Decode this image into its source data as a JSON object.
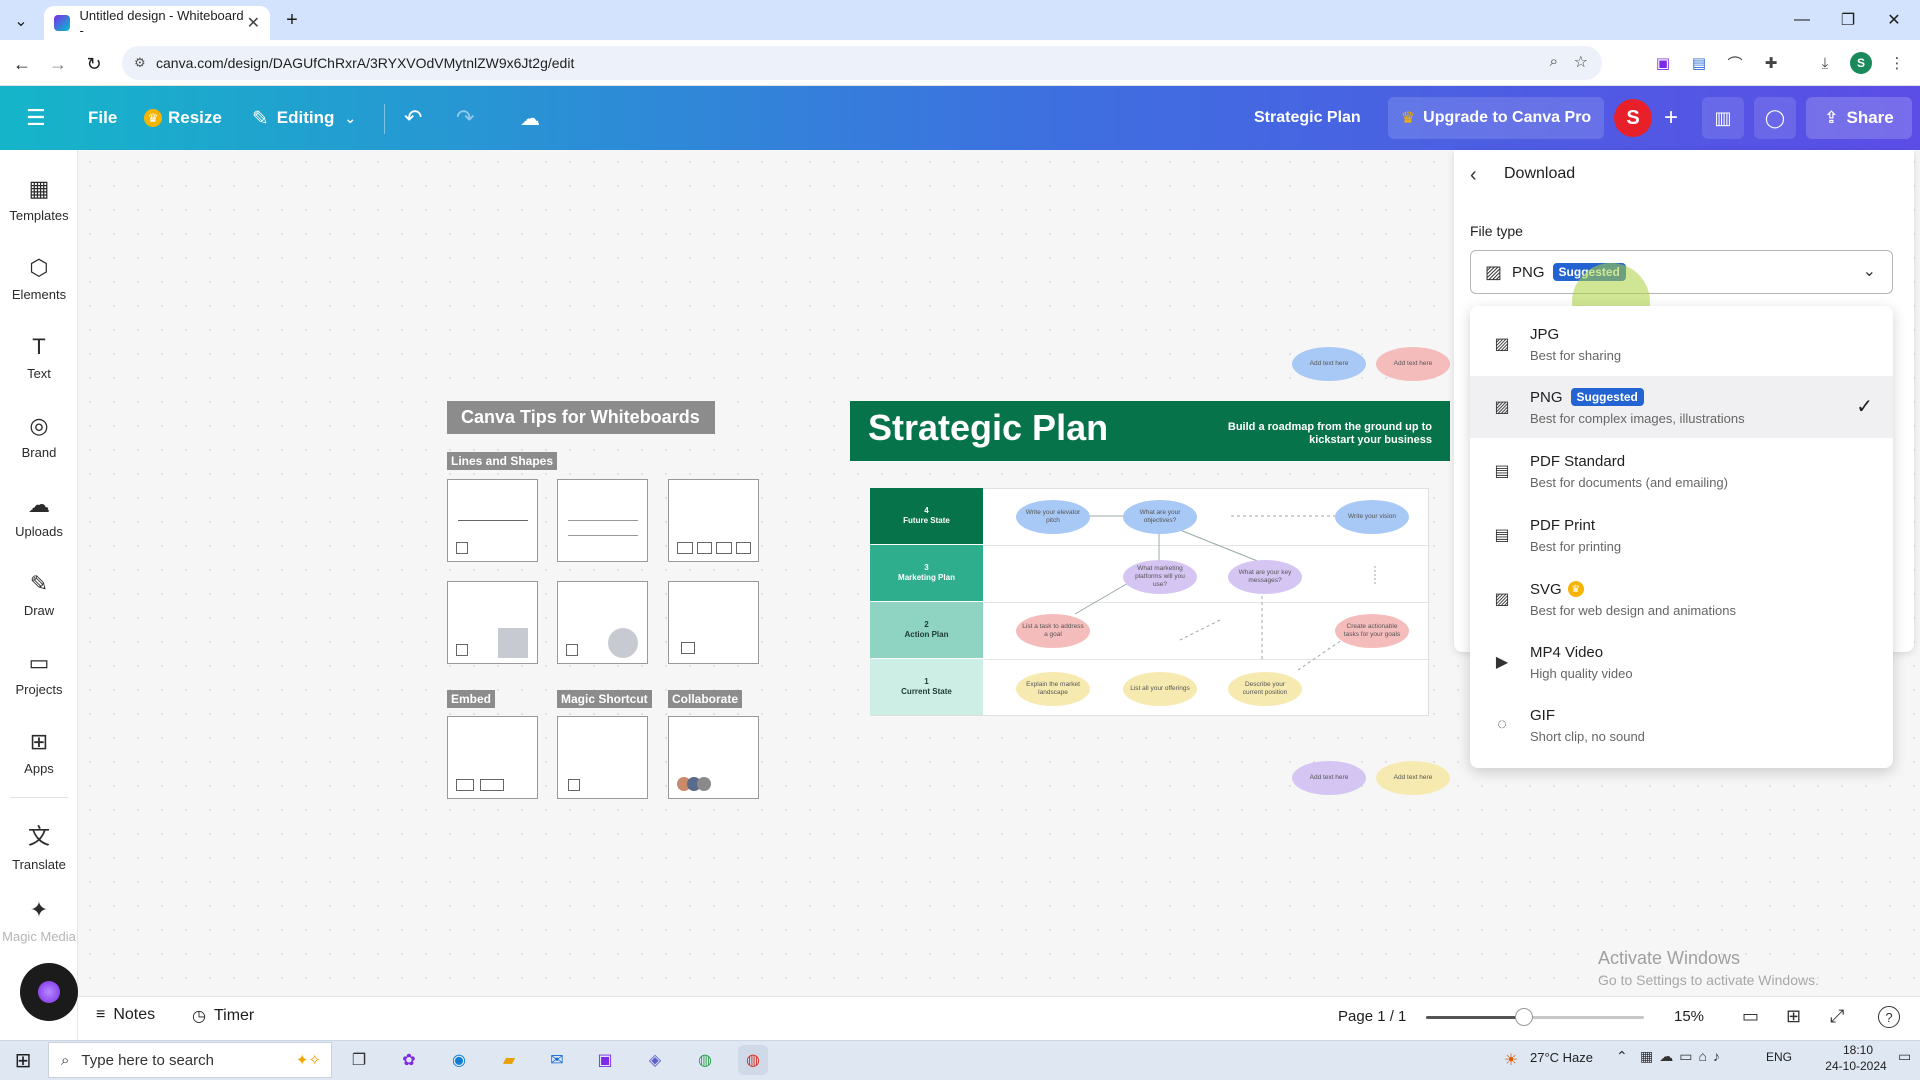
{
  "browser": {
    "tab_title": "Untitled design - Whiteboard -",
    "url": "canva.com/design/DAGUfChRxrA/3RYXVOdVMytnlZW9x6Jt2g/edit"
  },
  "toolbar": {
    "file": "File",
    "resize": "Resize",
    "editing": "Editing",
    "doc_title": "Strategic Plan",
    "upgrade": "Upgrade to Canva Pro",
    "avatar_letter": "S",
    "share": "Share"
  },
  "sidebar": {
    "items": [
      {
        "label": "Templates",
        "icon": "templates-icon"
      },
      {
        "label": "Elements",
        "icon": "elements-icon"
      },
      {
        "label": "Text",
        "icon": "text-icon"
      },
      {
        "label": "Brand",
        "icon": "brand-icon"
      },
      {
        "label": "Uploads",
        "icon": "uploads-icon"
      },
      {
        "label": "Draw",
        "icon": "draw-icon"
      },
      {
        "label": "Projects",
        "icon": "projects-icon"
      },
      {
        "label": "Apps",
        "icon": "apps-icon"
      },
      {
        "label": "Translate",
        "icon": "translate-icon"
      },
      {
        "label": "Magic Media",
        "icon": "magic-media-icon"
      }
    ]
  },
  "canvas": {
    "tips_title": "Canva Tips for Whiteboards",
    "lines_shapes": "Lines and Shapes",
    "embed": "Embed",
    "magic_shortcut": "Magic Shortcut",
    "collaborate": "Collaborate",
    "plan_title": "Strategic Plan",
    "plan_subtitle": "Build a roadmap from the ground up to kickstart your business",
    "rows": [
      {
        "num": "4",
        "label": "Future State"
      },
      {
        "num": "3",
        "label": "Marketing Plan"
      },
      {
        "num": "2",
        "label": "Action Plan"
      },
      {
        "num": "1",
        "label": "Current State"
      }
    ],
    "bubbles": {
      "b1": "Write your elevator pitch",
      "b2": "What are your objectives?",
      "b3": "Write your vision",
      "b4": "What marketing platforms will you use?",
      "b5": "What are your key messages?",
      "b6": "List a task to address a goal",
      "b7": "Create actionable tasks for your goals",
      "b8": "Explain the market landscape",
      "b9": "List all your offerings",
      "b10": "Describe your current position",
      "add": "Add text here"
    },
    "watermark1": "Activate Windows",
    "watermark2": "Go to Settings to activate Windows."
  },
  "download": {
    "title": "Download",
    "file_type_label": "File type",
    "selected": "PNG",
    "suggested": "Suggested",
    "options": [
      {
        "name": "JPG",
        "desc": "Best for sharing"
      },
      {
        "name": "PNG",
        "desc": "Best for complex images, illustrations"
      },
      {
        "name": "PDF Standard",
        "desc": "Best for documents (and emailing)"
      },
      {
        "name": "PDF Print",
        "desc": "Best for printing"
      },
      {
        "name": "SVG",
        "desc": "Best for web design and animations"
      },
      {
        "name": "MP4 Video",
        "desc": "High quality video"
      },
      {
        "name": "GIF",
        "desc": "Short clip, no sound"
      }
    ]
  },
  "bottombar": {
    "notes": "Notes",
    "timer": "Timer",
    "page": "Page 1 / 1",
    "zoom": "15%",
    "zoom_fraction": 0.45
  },
  "taskbar": {
    "search_placeholder": "Type here to search",
    "weather": "27°C  Haze",
    "lang": "ENG",
    "time": "18:10",
    "date": "24-10-2024"
  }
}
